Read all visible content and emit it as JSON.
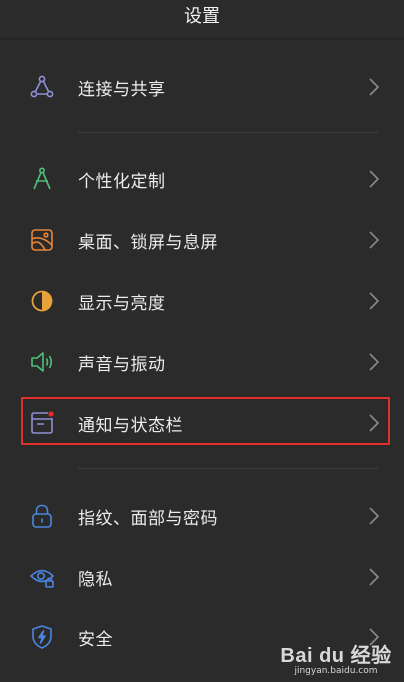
{
  "header": {
    "title": "设置"
  },
  "settings_items": [
    {
      "label": "连接与共享",
      "icon": "share-network-icon",
      "color": "#8f8fd6"
    },
    {
      "label": "个性化定制",
      "icon": "compass-icon",
      "color": "#4ec07a"
    },
    {
      "label": "桌面、锁屏与息屏",
      "icon": "wallpaper-icon",
      "color": "#e8863a"
    },
    {
      "label": "显示与亮度",
      "icon": "brightness-icon",
      "color": "#e8a23a"
    },
    {
      "label": "声音与振动",
      "icon": "speaker-icon",
      "color": "#4ec07a"
    },
    {
      "label": "通知与状态栏",
      "icon": "notification-icon",
      "color": "#8f8fd6"
    },
    {
      "label": "指纹、面部与密码",
      "icon": "lock-icon",
      "color": "#4a86e0"
    },
    {
      "label": "隐私",
      "icon": "privacy-eye-icon",
      "color": "#4a86e0"
    },
    {
      "label": "安全",
      "icon": "security-shield-icon",
      "color": "#4a86e0"
    }
  ],
  "highlight_color": "#e0302a",
  "watermark": {
    "brand": "Bai du 经验",
    "url": "jingyan.baidu.com"
  }
}
